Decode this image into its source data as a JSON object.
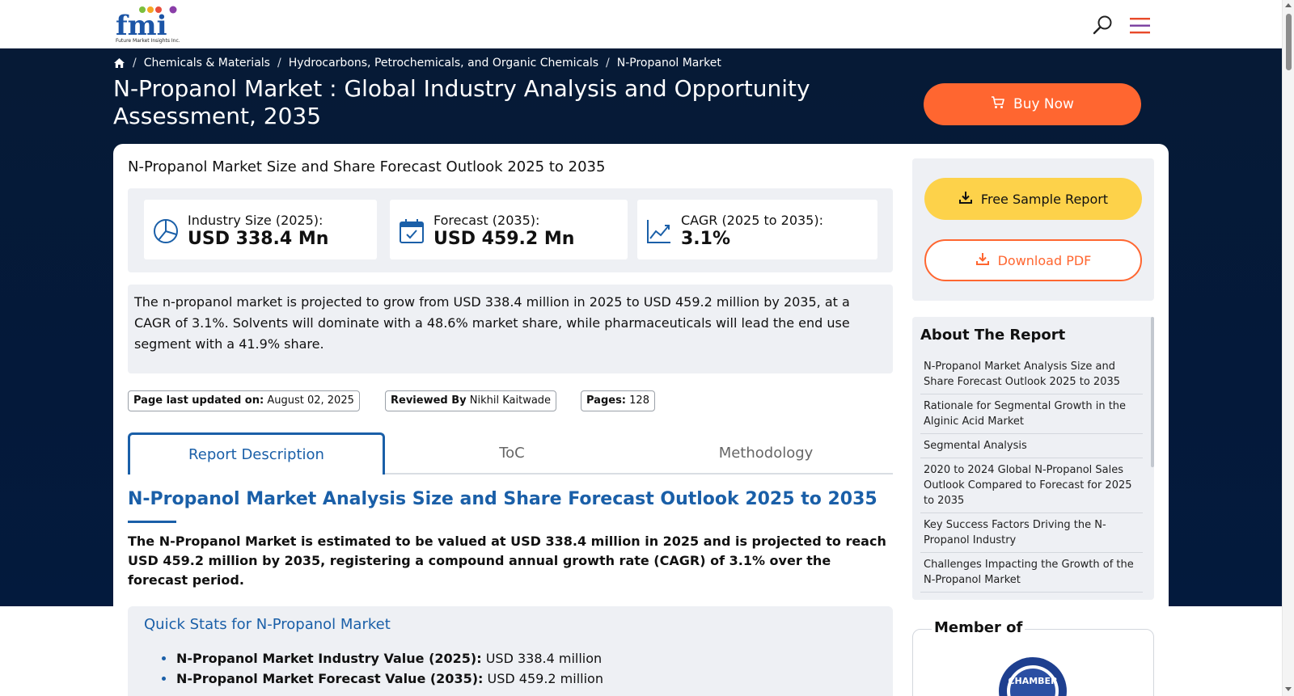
{
  "header": {
    "logo_text": "Future Market Insights Inc.",
    "logo_letters": "fmi",
    "search_icon": "search-icon",
    "menu_icon": "hamburger-menu-icon"
  },
  "breadcrumb": {
    "home_icon": "home-icon",
    "items": [
      "Chemicals & Materials",
      "Hydrocarbons, Petrochemicals, and Organic Chemicals",
      "N-Propanol Market"
    ],
    "separator": "/"
  },
  "hero": {
    "title": "N-Propanol Market : Global Industry Analysis and Opportunity Assessment, 2035",
    "buy_now_label": "Buy Now"
  },
  "overview": {
    "heading": "N-Propanol Market Size and Share Forecast Outlook 2025 to 2035",
    "stats": [
      {
        "label": "Industry Size (2025):",
        "value": "USD 338.4 Mn",
        "icon": "pie-chart-icon"
      },
      {
        "label": "Forecast (2035):",
        "value": "USD 459.2 Mn",
        "icon": "calendar-icon"
      },
      {
        "label": "CAGR (2025 to 2035):",
        "value": "3.1%",
        "icon": "trend-line-icon"
      }
    ],
    "summary": "The n-propanol market is projected to grow from USD 338.4 million in 2025 to USD 459.2 million by 2035, at a CAGR of 3.1%. Solvents will dominate with a 48.6% market share, while pharmaceuticals will lead the end use segment with a 41.9% share."
  },
  "meta": {
    "updated_label": "Page last updated on:",
    "updated_value": "August 02, 2025",
    "reviewed_label": "Reviewed By",
    "reviewed_value": "Nikhil Kaitwade",
    "pages_label": "Pages:",
    "pages_value": "128"
  },
  "tabs": [
    {
      "label": "Report Description",
      "active": true
    },
    {
      "label": "ToC",
      "active": false
    },
    {
      "label": "Methodology",
      "active": false
    }
  ],
  "content": {
    "heading": "N-Propanol Market Analysis Size and Share Forecast Outlook 2025 to 2035",
    "lead": "The N-Propanol Market is estimated to be valued at USD 338.4 million in 2025 and is projected to reach USD 459.2 million by 2035, registering a compound annual growth rate (CAGR) of 3.1% over the forecast period.",
    "quick_stats_title": "Quick Stats for N-Propanol Market",
    "quick_stats": [
      {
        "label": "N-Propanol Market Industry Value (2025):",
        "value": "USD 338.4 million"
      },
      {
        "label": "N-Propanol Market Forecast Value (2035):",
        "value": "USD 459.2 million"
      }
    ]
  },
  "sidebar": {
    "free_sample_label": "Free Sample Report",
    "download_pdf_label": "Download PDF",
    "about_title": "About The Report",
    "about_items": [
      "N-Propanol Market Analysis Size and Share Forecast Outlook 2025 to 2035",
      "Rationale for Segmental Growth in the Alginic Acid Market",
      "Segmental Analysis",
      "2020 to 2024 Global N-Propanol Sales Outlook Compared to Forecast for 2025 to 2035",
      "Key Success Factors Driving the N-Propanol Industry",
      "Challenges Impacting the Growth of the N-Propanol Market"
    ],
    "member_title": "Member of",
    "member_logo_text": "CHAMBER"
  },
  "colors": {
    "navy": "#04193a",
    "orange": "#ff6630",
    "yellow": "#fdd24a",
    "link_blue": "#1a5fa8",
    "panel_gray": "#eef0f4"
  }
}
